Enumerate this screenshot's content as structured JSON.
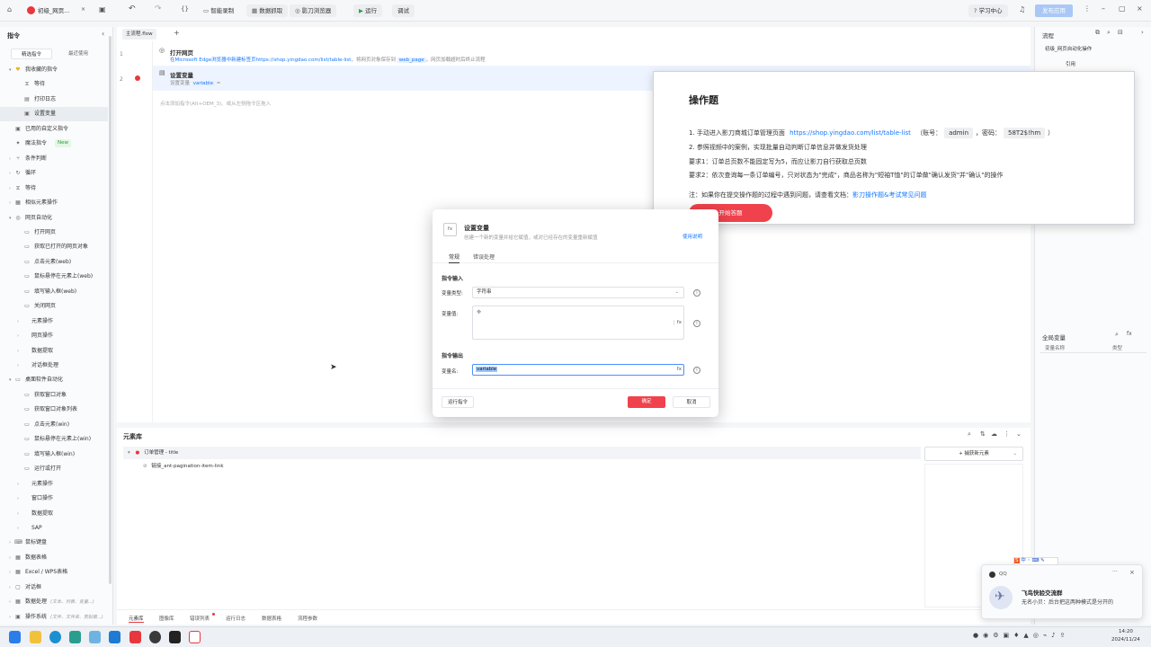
{
  "titlebar": {
    "doc_title": "初级_网页...",
    "smart_record": "智能录制",
    "data_grab": "数据抓取",
    "yingdao_browser": "影刀浏览器",
    "run": "运行",
    "debug": "调试",
    "learn_center": "学习中心",
    "publish": "发布应用"
  },
  "sidebar": {
    "title": "指令",
    "tab_recommend": "精选指令",
    "tab_recent": "最近使用",
    "items": [
      {
        "label": "我收藏的指令",
        "level": 0,
        "arrow": "▾",
        "icon": "♥"
      },
      {
        "label": "等待",
        "level": 1,
        "icon": "⧖"
      },
      {
        "label": "打印日志",
        "level": 1,
        "icon": "▤"
      },
      {
        "label": "设置变量",
        "level": 1,
        "icon": "▣"
      },
      {
        "label": "已用的自定义指令",
        "level": 0,
        "icon": "▣"
      },
      {
        "label": "魔法指令",
        "level": 0,
        "icon": "✦",
        "badge": "New"
      },
      {
        "label": "条件判断",
        "level": 0,
        "arrow": "›",
        "icon": "⑂"
      },
      {
        "label": "循环",
        "level": 0,
        "arrow": "›",
        "icon": "↻"
      },
      {
        "label": "等待",
        "level": 0,
        "arrow": "›",
        "icon": "⧖"
      },
      {
        "label": "相似元素操作",
        "level": 0,
        "arrow": "›",
        "icon": "▦"
      },
      {
        "label": "网页自动化",
        "level": 0,
        "arrow": "▾",
        "icon": "◎"
      },
      {
        "label": "打开网页",
        "level": 1,
        "icon": "▭"
      },
      {
        "label": "获取已打开的网页对象",
        "level": 1,
        "icon": "▭"
      },
      {
        "label": "点击元素(web)",
        "level": 1,
        "icon": "▭"
      },
      {
        "label": "鼠标悬停在元素上(web)",
        "level": 1,
        "icon": "▭"
      },
      {
        "label": "填写输入框(web)",
        "level": 1,
        "icon": "▭"
      },
      {
        "label": "关闭网页",
        "level": 1,
        "icon": "▭"
      },
      {
        "label": "元素操作",
        "level": 1,
        "arrow": "›"
      },
      {
        "label": "网页操作",
        "level": 1,
        "arrow": "›"
      },
      {
        "label": "数据提取",
        "level": 1,
        "arrow": "›"
      },
      {
        "label": "对话框处理",
        "level": 1,
        "arrow": "›"
      },
      {
        "label": "桌面软件自动化",
        "level": 0,
        "arrow": "▾",
        "icon": "▭"
      },
      {
        "label": "获取窗口对象",
        "level": 1,
        "icon": "▭"
      },
      {
        "label": "获取窗口对象列表",
        "level": 1,
        "icon": "▭"
      },
      {
        "label": "点击元素(win)",
        "level": 1,
        "icon": "▭"
      },
      {
        "label": "鼠标悬停在元素上(win)",
        "level": 1,
        "icon": "▭"
      },
      {
        "label": "填写输入框(win)",
        "level": 1,
        "icon": "▭"
      },
      {
        "label": "运行或打开",
        "level": 1,
        "icon": "▭"
      },
      {
        "label": "元素操作",
        "level": 1,
        "arrow": "›"
      },
      {
        "label": "窗口操作",
        "level": 1,
        "arrow": "›"
      },
      {
        "label": "数据提取",
        "level": 1,
        "arrow": "›"
      },
      {
        "label": "SAP",
        "level": 1,
        "arrow": "›"
      },
      {
        "label": "鼠标键盘",
        "level": 0,
        "arrow": "›",
        "icon": "⌨"
      },
      {
        "label": "数据表格",
        "level": 0,
        "arrow": "›",
        "icon": "▦"
      },
      {
        "label": "Excel / WPS表格",
        "level": 0,
        "arrow": "›",
        "icon": "▦"
      },
      {
        "label": "对话框",
        "level": 0,
        "arrow": "›",
        "icon": "▢"
      },
      {
        "label": "数据处理",
        "level": 0,
        "arrow": "›",
        "icon": "▦",
        "hint": "(文本、列表、变量...)"
      },
      {
        "label": "操作系统",
        "level": 0,
        "arrow": "›",
        "icon": "▣",
        "hint": "(文件、文件夹、剪贴板...)"
      }
    ]
  },
  "editor": {
    "tab_main": "主流程.flow",
    "add_tab": "+",
    "step1_num": "1",
    "step1_title": "打开网页",
    "step1_desc_a": "在Microsoft Edge浏览器中新建标签页",
    "step1_desc_b": "https://shop.yingdao.com/list/table-list",
    "step1_desc_c": "，将网页对象保存到",
    "step1_var": "web_page",
    "step1_desc_d": "，网页加载超时后终止流程",
    "step2_num": "2",
    "step2_title": "设置变量",
    "step2_desc": "设置变量",
    "step2_var": "variable",
    "step2_eq": "=",
    "add_hint": "点击添加指令(Alt+OEM_3)、或从左侧拖令区拖入"
  },
  "element_library": {
    "title": "元素库",
    "group_name": "订单管理 - title",
    "child_name": "链接_ant-pagination-item-link",
    "capture_button": "捕获新元素",
    "tabs": [
      "元素库",
      "图像库",
      "错误列表",
      "运行日志",
      "数据表格",
      "流程参数"
    ]
  },
  "right_panel": {
    "flow_title": "流程",
    "flow_name": "初级_网页自动化操作",
    "flow_ref": "引用",
    "global_vars": "全局变量",
    "col_name": "变量名称",
    "col_type": "类型"
  },
  "exam": {
    "title": "操作题",
    "line1_prefix": "1. 手动进入影刀商城订单管理页面",
    "line1_url": "https://shop.yingdao.com/list/table-list",
    "line1_account_label": "（账号：",
    "line1_account": "admin",
    "line1_pwd_label": "，密码：",
    "line1_pwd": "58T2$!hm",
    "line1_close": "）",
    "line2": "2. 参照视频中的案例，实现批量自动判断订单信息并做发货处理",
    "line3": "要求1：订单总页数不能固定写为5，而应让影刀自行获取总页数",
    "line4": "要求2：依次查询每一条订单编号，只对状态为\"完成\"，商品名称为\"短袖T恤\"的订单做\"确认发货\"并\"确认\"的操作",
    "note_prefix": "注：如果你在提交操作题的过程中遇到问题，请查看文档：",
    "note_link": "影刀操作题&考试常见问题",
    "start_button": "开始答题"
  },
  "dialog": {
    "title": "设置变量",
    "subtitle": "创建一个新的变量并给它赋值，或对已经存在的变量重新赋值",
    "help": "使用说明",
    "tab_general": "常规",
    "tab_error": "错误处理",
    "section_input": "指令输入",
    "type_label": "变量类型:",
    "type_value": "字符串",
    "value_label": "变量值:",
    "section_output": "指令输出",
    "name_label": "变量名:",
    "name_value": "variable",
    "run_button": "运行指令",
    "ok_button": "确定",
    "cancel_button": "取消"
  },
  "qq": {
    "app": "QQ",
    "group": "飞鸟快验交流群",
    "message": "无名小贝：后台把这两种模式是分开的"
  },
  "taskbar": {
    "time": "14:20",
    "date": "2024/11/24"
  },
  "colors": {
    "accent": "#f0424c",
    "link": "#1677ff",
    "publish": "#a9c8f5"
  }
}
